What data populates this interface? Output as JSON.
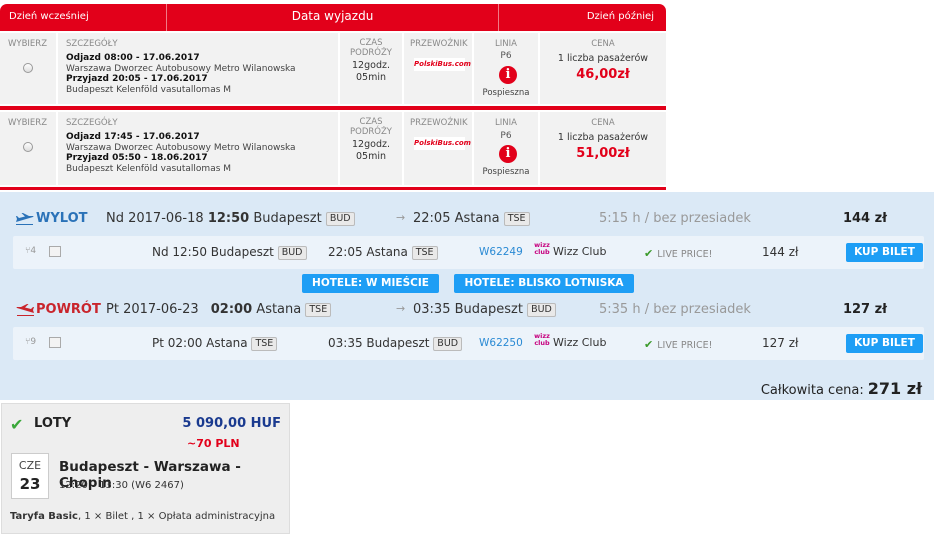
{
  "bus": {
    "header": {
      "prev_day": "Dzień wcześniej",
      "title": "Data wyjazdu",
      "next_day": "Dzień później"
    },
    "columns": {
      "select": "WYBIERZ",
      "details": "SZCZEGÓŁY",
      "travel_time": "CZAS PODRÓŻY",
      "carrier": "PRZEWOŹNIK",
      "line": "LINIA",
      "price": "CENA"
    },
    "rows": [
      {
        "departure": "Odjazd 08:00 - 17.06.2017",
        "from": "Warszawa Dworzec Autobusowy Metro Wilanowska",
        "arrival": "Przyjazd 20:05 - 17.06.2017",
        "to": "Budapeszt Kelenföld vasutallomas M",
        "duration_h": "12godz.",
        "duration_m": "05min",
        "carrier": "PolskiBus.com",
        "line": "P6",
        "line_type": "Pospieszna",
        "passengers": "1 liczba pasażerów",
        "price": "46,00zł"
      },
      {
        "departure": "Odjazd 17:45 - 17.06.2017",
        "from": "Warszawa Dworzec Autobusowy Metro Wilanowska",
        "arrival": "Przyjazd 05:50 - 18.06.2017",
        "to": "Budapeszt Kelenföld vasutallomas M",
        "duration_h": "12godz.",
        "duration_m": "05min",
        "carrier": "PolskiBus.com",
        "line": "P6",
        "line_type": "Pospieszna",
        "passengers": "1 liczba pasażerów",
        "price": "51,00zł"
      }
    ]
  },
  "flights": {
    "outbound": {
      "label": "WYLOT",
      "date": "Nd 2017-06-18",
      "dep_time": "12:50",
      "from": "Budapeszt",
      "from_code": "BUD",
      "arr_time": "22:05",
      "to": "Astana",
      "to_code": "TSE",
      "duration": "5:15 h / bez przesiadek",
      "price": "144 zł",
      "detail": {
        "seats": "4",
        "dep": "Nd 12:50 Budapeszt",
        "dep_code": "BUD",
        "arr": "22:05 Astana",
        "arr_code": "TSE",
        "flight_no": "W62249",
        "airline_logo": "wizz",
        "airline": "Wizz Club",
        "live": "LIVE PRICE!",
        "price": "144 zł",
        "buy": "KUP BILET"
      }
    },
    "hotel_buttons": [
      "HOTELE: W MIEŚCIE",
      "HOTELE: BLISKO LOTNISKA"
    ],
    "return": {
      "label": "POWRÓT",
      "date": "Pt 2017-06-23",
      "dep_time": "02:00",
      "from": "Astana",
      "from_code": "TSE",
      "arr_time": "03:35",
      "to": "Budapeszt",
      "to_code": "BUD",
      "duration": "5:35 h / bez przesiadek",
      "price": "127 zł",
      "detail": {
        "seats": "9",
        "dep": "Pt 02:00 Astana",
        "dep_code": "TSE",
        "arr": "03:35 Budapeszt",
        "arr_code": "BUD",
        "flight_no": "W62250",
        "airline_logo": "wizz",
        "airline": "Wizz Club",
        "live": "LIVE PRICE!",
        "price": "127 zł",
        "buy": "KUP BILET"
      }
    },
    "total_label": "Całkowita cena:",
    "total_value": "271 zł"
  },
  "loty": {
    "title": "LOTY",
    "price_huf": "5 090,00 HUF",
    "price_pln": "~70 PLN",
    "dow": "CZE",
    "day": "23",
    "route": "Budapeszt - Warszawa - Chopin",
    "times": "12:20 – 13:30 (W6 2467)",
    "tariff_label": "Taryfa Basic",
    "tariff_rest": ", 1 × Bilet , 1 × Opłata administracyjna"
  },
  "colors": {
    "brand_red": "#e2001a",
    "panel_blue": "#dbe9f6",
    "button_blue": "#1e9ef5"
  }
}
